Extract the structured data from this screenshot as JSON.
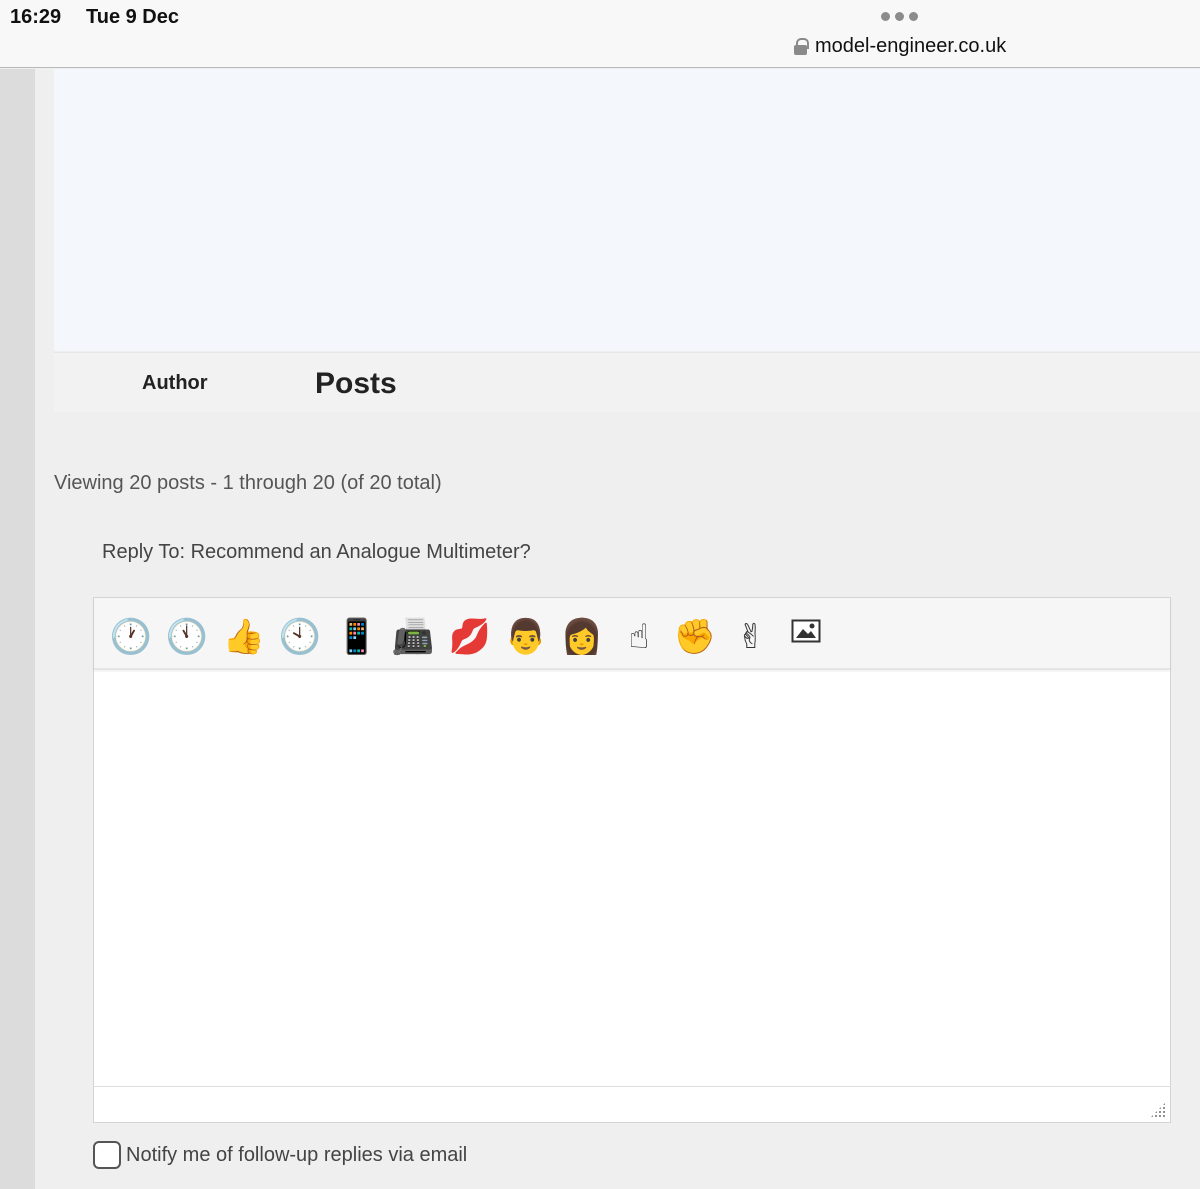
{
  "status_bar": {
    "time": "16:29",
    "date": "Tue 9 Dec",
    "url": "model-engineer.co.uk"
  },
  "forum_header": {
    "author_label": "Author",
    "posts_label": "Posts"
  },
  "viewing_text": "Viewing 20 posts - 1 through 20 (of 20 total)",
  "reply_to_text": "Reply To: Recommend an Analogue Multimeter?",
  "toolbar": {
    "buttons": [
      {
        "icon": "clock-one-icon",
        "glyph": "🕐"
      },
      {
        "icon": "clock-eleven-icon",
        "glyph": "🕚"
      },
      {
        "icon": "thumbs-up-icon",
        "glyph": "👍"
      },
      {
        "icon": "clock-ten-icon",
        "glyph": "🕙"
      },
      {
        "icon": "mobile-phone-icon",
        "glyph": "📱"
      },
      {
        "icon": "fax-machine-icon",
        "glyph": "📠"
      },
      {
        "icon": "kiss-mark-icon",
        "glyph": "💋"
      },
      {
        "icon": "man-face-icon",
        "glyph": "👨"
      },
      {
        "icon": "woman-face-icon",
        "glyph": "👩"
      },
      {
        "icon": "index-pointing-up-icon",
        "glyph": "☝"
      },
      {
        "icon": "raised-fist-icon",
        "glyph": "✊"
      },
      {
        "icon": "victory-hand-icon",
        "glyph": "✌"
      },
      {
        "icon": "insert-image-icon",
        "glyph": "🖼"
      }
    ]
  },
  "editor": {
    "text_value": ""
  },
  "notify": {
    "label": "Notify me of follow-up replies via email",
    "checked": false
  }
}
